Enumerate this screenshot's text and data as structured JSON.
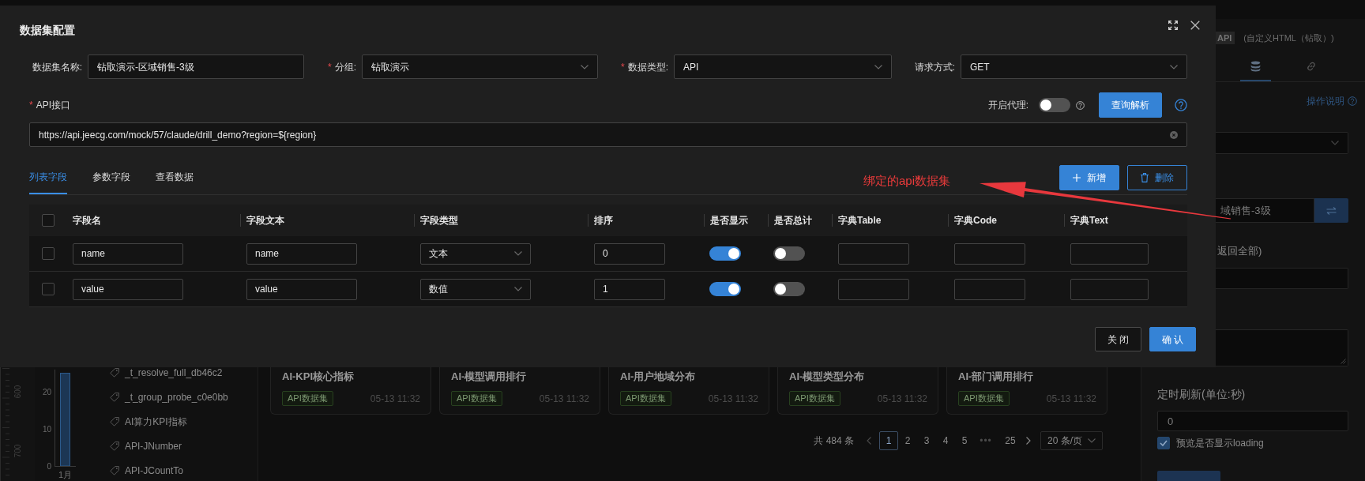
{
  "modal": {
    "title": "数据集配置",
    "fields": [
      {
        "label": "数据集名称:",
        "kind": "input",
        "value": "钻取演示-区域销售-3级"
      },
      {
        "required_mark": "*",
        "label": "分组:",
        "kind": "select",
        "value": "钻取演示"
      },
      {
        "required_mark": "*",
        "label": "数据类型:",
        "kind": "select",
        "value": "API"
      },
      {
        "label": "请求方式:",
        "kind": "select",
        "value": "GET"
      }
    ],
    "api_field": {
      "required_mark": "*",
      "label": "API接口",
      "value": "https://api.jeecg.com/mock/57/claude/drill_demo?region=${region}"
    },
    "proxy": {
      "label": "开启代理:",
      "on": false
    },
    "parse_button": "查询解析",
    "tabs": [
      {
        "label": "列表字段",
        "selected": true
      },
      {
        "label": "参数字段",
        "selected": false
      },
      {
        "label": "查看数据",
        "selected": false
      }
    ],
    "actions": [
      {
        "kind": "add",
        "label": "新增"
      },
      {
        "kind": "delete",
        "label": "删除"
      }
    ],
    "table": {
      "all_checked": false,
      "columns": [
        {
          "label": "字段名",
          "kind": "input"
        },
        {
          "label": "字段文本",
          "kind": "input"
        },
        {
          "label": "字段类型",
          "kind": "select"
        },
        {
          "label": "排序",
          "kind": "input"
        },
        {
          "label": "是否显示",
          "kind": "switch"
        },
        {
          "label": "是否总计",
          "kind": "switch"
        },
        {
          "label": "字典Table",
          "kind": "input"
        },
        {
          "label": "字典Code",
          "kind": "input"
        },
        {
          "label": "字典Text",
          "kind": "input"
        }
      ],
      "rows": [
        {
          "checked": false,
          "cells": [
            {
              "value": "name"
            },
            {
              "value": "name"
            },
            {
              "value": "文本"
            },
            {
              "value": "0"
            },
            {
              "on": true
            },
            {
              "on": false
            }
          ]
        },
        {
          "checked": false,
          "cells": [
            {
              "value": "value"
            },
            {
              "value": "value"
            },
            {
              "value": "数值"
            },
            {
              "value": "1"
            },
            {
              "on": true
            },
            {
              "on": false
            }
          ]
        }
      ]
    },
    "footer_buttons": [
      {
        "kind": "default",
        "label": "关 闭"
      },
      {
        "kind": "primary",
        "label": "确 认"
      }
    ]
  },
  "annotation": {
    "text": "绑定的api数据集"
  },
  "ruler": {
    "labels": [
      "600",
      "700"
    ]
  },
  "canvas_chart": {
    "chart_data": {
      "type": "bar",
      "categories": [
        "1月"
      ],
      "values": [
        25
      ],
      "ylim": [
        0,
        26
      ],
      "yticks": [
        0,
        10,
        20
      ]
    }
  },
  "dataset_list": {
    "items": [
      "_t_resolve_full_db46c2",
      "_t_group_probe_c0e0bb",
      "AI算力KPI指标",
      "API-JNumber",
      "API-JCountTo"
    ]
  },
  "dataset_cards": [
    {
      "title": "AI-KPI核心指标",
      "tag": "API数据集",
      "time": "05-13 11:32"
    },
    {
      "title": "AI-模型调用排行",
      "tag": "API数据集",
      "time": "05-13 11:32"
    },
    {
      "title": "AI-用户地域分布",
      "tag": "API数据集",
      "time": "05-13 11:32"
    },
    {
      "title": "AI-模型类型分布",
      "tag": "API数据集",
      "time": "05-13 11:32"
    },
    {
      "title": "AI-部门调用排行",
      "tag": "API数据集",
      "time": "05-13 11:32"
    }
  ],
  "pagination": {
    "total": "共 484 条",
    "pages": [
      {
        "label": "1",
        "selected": true
      },
      {
        "label": "2",
        "selected": false
      },
      {
        "label": "3",
        "selected": false
      },
      {
        "label": "4",
        "selected": false
      },
      {
        "label": "5",
        "selected": false
      }
    ],
    "ellipsis": "•••",
    "last_page": {
      "label": "25",
      "selected": false
    },
    "page_size": "20 条/页"
  },
  "properties_panel": {
    "type_tag": "API",
    "type_desc": "(自定义HTML（钻取）)",
    "tabs": [
      {
        "kind": "dataset",
        "selected": true
      },
      {
        "kind": "link",
        "selected": false
      }
    ],
    "help_link": "操作说明",
    "binding_value": "域销售-3级",
    "note": "返回全部)",
    "refresh_label": "定时刷新(单位:秒)",
    "refresh_value": "0",
    "loading_option": {
      "label": "预览是否显示loading",
      "checked": true
    }
  }
}
